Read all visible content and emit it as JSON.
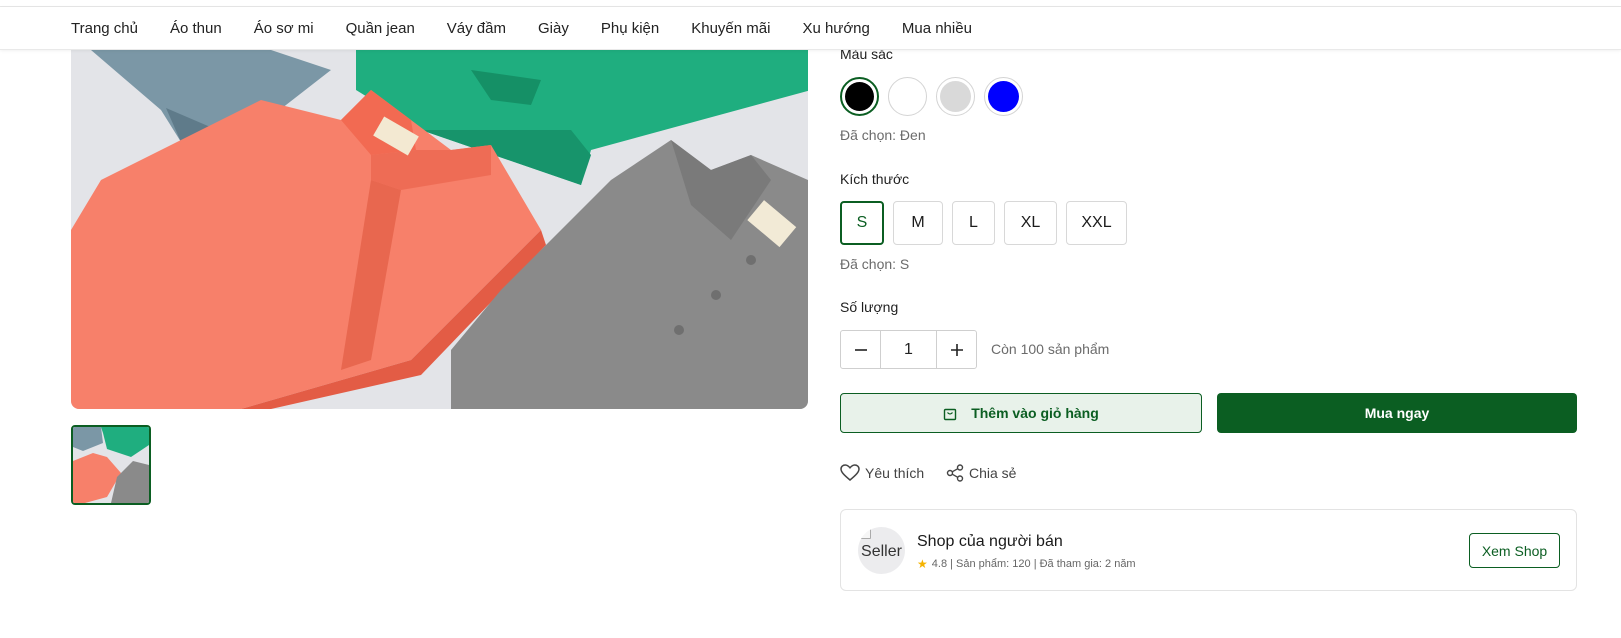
{
  "nav": {
    "items": [
      "Trang chủ",
      "Áo thun",
      "Áo sơ mi",
      "Quần jean",
      "Váy đầm",
      "Giày",
      "Phụ kiện",
      "Khuyến mãi",
      "Xu hướng",
      "Mua nhiều"
    ]
  },
  "product": {
    "color_label": "Màu sắc",
    "colors": [
      {
        "name": "Đen",
        "hex": "#000000",
        "selected": true
      },
      {
        "name": "Trắng",
        "hex": "#ffffff",
        "selected": false
      },
      {
        "name": "Xám",
        "hex": "#d9d9d9",
        "selected": false
      },
      {
        "name": "Xanh",
        "hex": "#0000ff",
        "selected": false
      }
    ],
    "selected_color_text": "Đã chọn: Đen",
    "size_label": "Kích thước",
    "sizes": [
      "S",
      "M",
      "L",
      "XL",
      "XXL"
    ],
    "selected_size_text": "Đã chọn: S",
    "quantity_label": "Số lượng",
    "quantity_value": "1",
    "stock_text": "Còn 100 sản phẩm",
    "add_to_cart_label": "Thêm vào giỏ hàng",
    "buy_now_label": "Mua ngay",
    "favorite_label": "Yêu thích",
    "share_label": "Chia sẻ"
  },
  "seller": {
    "avatar_alt": "Seller",
    "name": "Shop của người bán",
    "meta": "4.8 | Sản phẩm: 120 | Đã tham gia: 2 năm",
    "view_shop_label": "Xem Shop"
  },
  "colors": {
    "accent": "#0b5e22",
    "accent_light": "#e8f2ea",
    "star": "#f5b301"
  }
}
